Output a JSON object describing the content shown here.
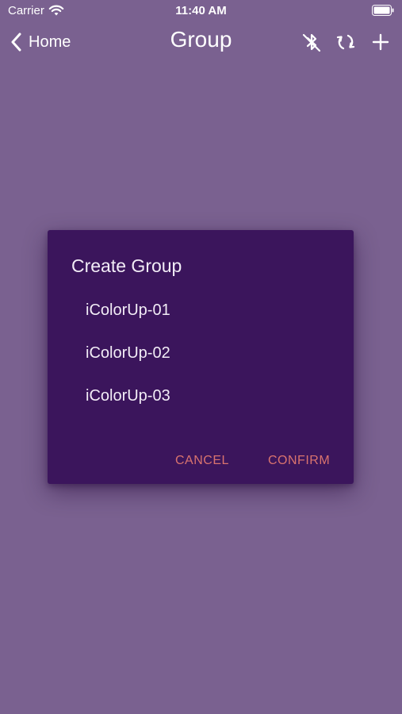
{
  "status_bar": {
    "carrier": "Carrier",
    "time": "11:40 AM",
    "icons": [
      "wifi-icon",
      "battery-icon"
    ]
  },
  "nav": {
    "back_label": "Home",
    "title": "Group",
    "icons": [
      "bluetooth-off-icon",
      "refresh-icon",
      "plus-icon"
    ]
  },
  "dialog": {
    "title": "Create Group",
    "devices": [
      "iColorUp-01",
      "iColorUp-02",
      "iColorUp-03"
    ],
    "cancel_label": "CANCEL",
    "confirm_label": "CONFIRM"
  },
  "colors": {
    "background": "#7a6190",
    "dialog": "#3b155c",
    "action_text": "#d9736e"
  }
}
